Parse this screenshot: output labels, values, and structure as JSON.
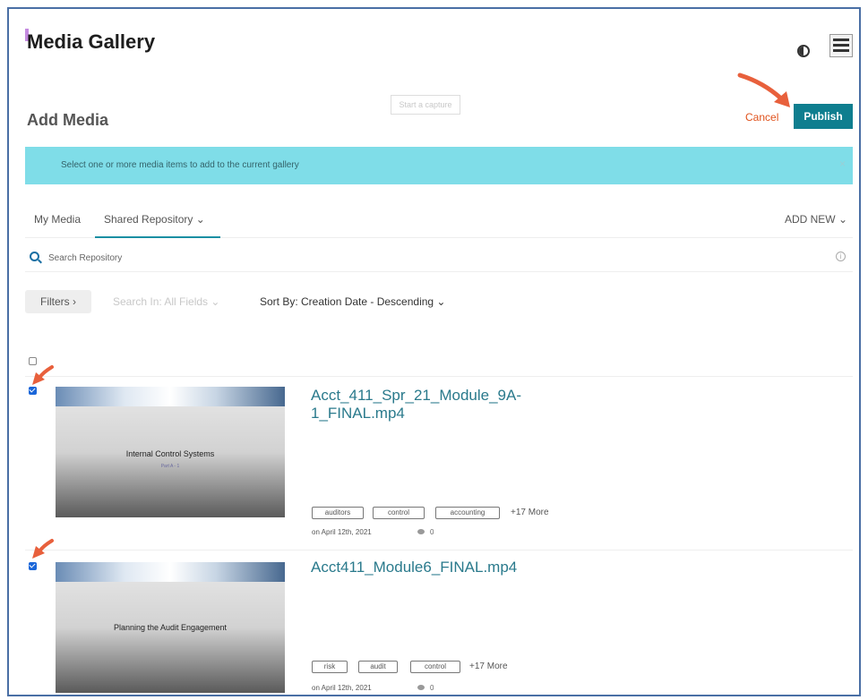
{
  "header": {
    "title": "Media Gallery",
    "contrast_icon": "contrast-icon",
    "menu_icon": "menu-icon"
  },
  "page": {
    "title": "Add Media",
    "capture_label": "Start a capture",
    "cancel_label": "Cancel",
    "publish_label": "Publish"
  },
  "banner": {
    "text": "Select one or more media items to add to the current gallery",
    "close": "×"
  },
  "tabs": {
    "my_media": "My Media",
    "shared_repository": "Shared Repository ⌄",
    "add_new": "ADD NEW ⌄"
  },
  "search": {
    "placeholder": "Search Repository",
    "info": "i"
  },
  "filters": {
    "filters_label": "Filters ›",
    "search_in": "Search In: All Fields ⌄",
    "sort_by": "Sort By: Creation Date - Descending ⌄"
  },
  "media_items": [
    {
      "thumb_title": "Internal Control Systems",
      "thumb_sub": "Part A - 1",
      "title": "Acct_411_Spr_21_Module_9A-1_FINAL.mp4",
      "tags": [
        "auditors",
        "control",
        "accounting"
      ],
      "more": "+17 More",
      "date": "on April 12th, 2021",
      "comments": "0",
      "selected": true
    },
    {
      "thumb_title": "Planning the Audit Engagement",
      "thumb_sub": "",
      "title": "Acct411_Module6_FINAL.mp4",
      "tags": [
        "risk",
        "audit",
        "control"
      ],
      "more": "+17 More",
      "date": "on April 12th, 2021",
      "comments": "0",
      "selected": true
    }
  ],
  "colors": {
    "publish": "#0f7e8f",
    "cancel": "#e0521c",
    "banner": "#7fdde8",
    "title_link": "#2a7a8c",
    "annotation_arrow": "#e8603c"
  }
}
